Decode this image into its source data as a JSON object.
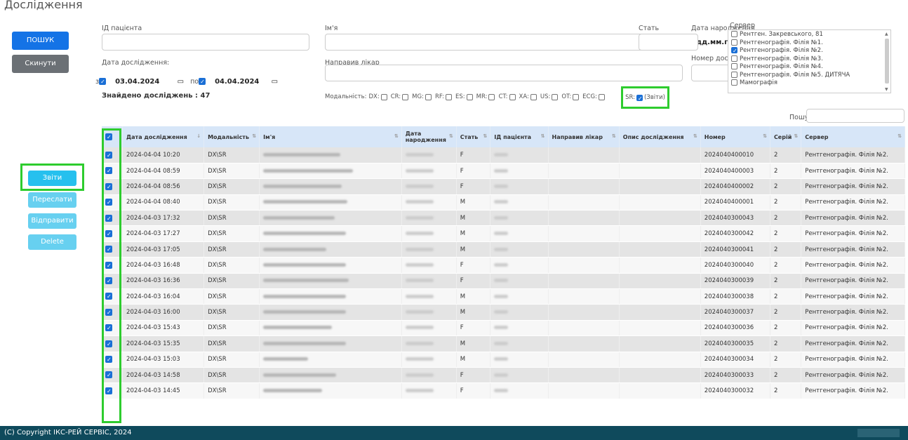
{
  "page_title": "Дослідження",
  "buttons": {
    "search": "ПОШУК",
    "reset": "Скинути"
  },
  "labels": {
    "patient_id": "ІД пацієнта",
    "name": "Ім'я",
    "birth_date": "Дата народження",
    "sex": "Стать",
    "server": "Сервер",
    "study_date": "Дата дослідження:",
    "referring_doctor": "Направив лікар",
    "study_number": "Номер дослідження",
    "from": "з",
    "to": "по",
    "found": "Знайдено досліджень : 47",
    "search_small": "Пошук:",
    "modality": "Модальність:"
  },
  "inputs": {
    "birth_date_placeholder": "дд.мм.гггг",
    "date_from": "03.04.2024",
    "date_to": "04.04.2024"
  },
  "modalities": [
    {
      "label": "DX:",
      "checked": false
    },
    {
      "label": "CR:",
      "checked": false
    },
    {
      "label": "MG:",
      "checked": false
    },
    {
      "label": "RF:",
      "checked": false
    },
    {
      "label": "ES:",
      "checked": false
    },
    {
      "label": "MR:",
      "checked": false
    },
    {
      "label": "CT:",
      "checked": false
    },
    {
      "label": "XA:",
      "checked": false
    },
    {
      "label": "US:",
      "checked": false
    },
    {
      "label": "OT:",
      "checked": false
    },
    {
      "label": "ECG:",
      "checked": false
    }
  ],
  "sr_modality": {
    "label": "SR:",
    "suffix": "(Звіти)",
    "checked": true
  },
  "servers": [
    {
      "label": "Рентген. Закревського, 81",
      "checked": false
    },
    {
      "label": "Рентгенографія. Філія №1.",
      "checked": false
    },
    {
      "label": "Рентгенографія. Філія №2.",
      "checked": true
    },
    {
      "label": "Рентгенографія. Філія №3.",
      "checked": false
    },
    {
      "label": "Рентгенографія. Філія №4.",
      "checked": false
    },
    {
      "label": "Рентгенографія. Філія №5. ДИТЯЧА",
      "checked": false
    },
    {
      "label": "Мамографія",
      "checked": false
    }
  ],
  "side_buttons": {
    "reports": "Звіти",
    "forward": "Переслати",
    "send": "Відправити",
    "delete": "Delete"
  },
  "table": {
    "columns": [
      "Дата дослідження",
      "Модальність",
      "Ім'я",
      "Дата народження",
      "Стать",
      "ІД пацієнта",
      "Направив лікар",
      "Опис дослідження",
      "Номер",
      "Серій",
      "Сервер"
    ],
    "rows": [
      {
        "date": "2024-04-04 10:20",
        "mod": "DX\\SR",
        "sex": "F",
        "num": "2024040400010",
        "series": "2",
        "server": "Рентгенографія. Філія №2."
      },
      {
        "date": "2024-04-04 08:59",
        "mod": "DX\\SR",
        "sex": "F",
        "num": "2024040400003",
        "series": "2",
        "server": "Рентгенографія. Філія №2."
      },
      {
        "date": "2024-04-04 08:56",
        "mod": "DX\\SR",
        "sex": "F",
        "num": "2024040400002",
        "series": "2",
        "server": "Рентгенографія. Філія №2."
      },
      {
        "date": "2024-04-04 08:40",
        "mod": "DX\\SR",
        "sex": "M",
        "num": "2024040400001",
        "series": "2",
        "server": "Рентгенографія. Філія №2."
      },
      {
        "date": "2024-04-03 17:32",
        "mod": "DX\\SR",
        "sex": "M",
        "num": "2024040300043",
        "series": "2",
        "server": "Рентгенографія. Філія №2."
      },
      {
        "date": "2024-04-03 17:27",
        "mod": "DX\\SR",
        "sex": "M",
        "num": "2024040300042",
        "series": "2",
        "server": "Рентгенографія. Філія №2."
      },
      {
        "date": "2024-04-03 17:05",
        "mod": "DX\\SR",
        "sex": "M",
        "num": "2024040300041",
        "series": "2",
        "server": "Рентгенографія. Філія №2."
      },
      {
        "date": "2024-04-03 16:48",
        "mod": "DX\\SR",
        "sex": "F",
        "num": "2024040300040",
        "series": "2",
        "server": "Рентгенографія. Філія №2."
      },
      {
        "date": "2024-04-03 16:36",
        "mod": "DX\\SR",
        "sex": "F",
        "num": "2024040300039",
        "series": "2",
        "server": "Рентгенографія. Філія №2."
      },
      {
        "date": "2024-04-03 16:04",
        "mod": "DX\\SR",
        "sex": "M",
        "num": "2024040300038",
        "series": "2",
        "server": "Рентгенографія. Філія №2."
      },
      {
        "date": "2024-04-03 16:00",
        "mod": "DX\\SR",
        "sex": "M",
        "num": "2024040300037",
        "series": "2",
        "server": "Рентгенографія. Філія №2."
      },
      {
        "date": "2024-04-03 15:43",
        "mod": "DX\\SR",
        "sex": "F",
        "num": "2024040300036",
        "series": "2",
        "server": "Рентгенографія. Філія №2."
      },
      {
        "date": "2024-04-03 15:35",
        "mod": "DX\\SR",
        "sex": "M",
        "num": "2024040300035",
        "series": "2",
        "server": "Рентгенографія. Філія №2."
      },
      {
        "date": "2024-04-03 15:03",
        "mod": "DX\\SR",
        "sex": "M",
        "num": "2024040300034",
        "series": "2",
        "server": "Рентгенографія. Філія №2."
      },
      {
        "date": "2024-04-03 14:58",
        "mod": "DX\\SR",
        "sex": "F",
        "num": "2024040300033",
        "series": "2",
        "server": "Рентгенографія. Філія №2."
      },
      {
        "date": "2024-04-03 14:45",
        "mod": "DX\\SR",
        "sex": "F",
        "num": "2024040300032",
        "series": "2",
        "server": "Рентгенографія. Філія №2."
      }
    ]
  },
  "footer": {
    "copyright": "(C) Copyright ІКС-РЕЙ СЕРВІС, 2024"
  },
  "colors": {
    "primary": "#1473e6",
    "secondary": "#6b7075",
    "info": "#67d0f0",
    "highlight": "#2ecc2e",
    "header_bg": "#d7e6f8",
    "footer_bg": "#0f4a5c"
  }
}
